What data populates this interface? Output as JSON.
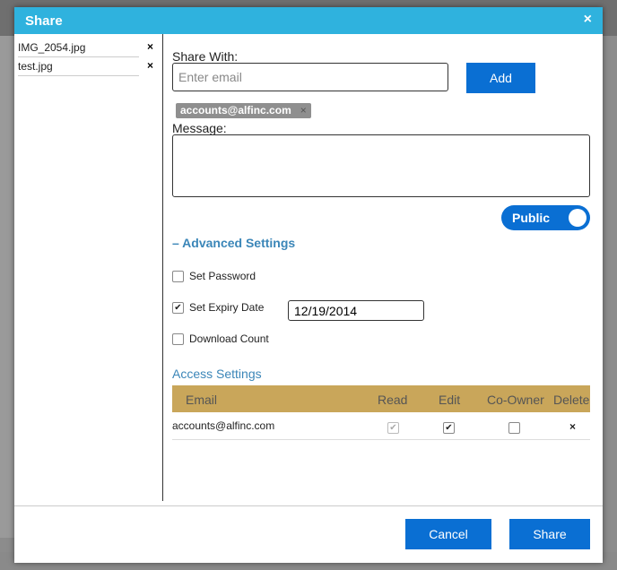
{
  "modal": {
    "title": "Share",
    "close_icon": "×"
  },
  "files": [
    {
      "name": "IMG_2054.jpg",
      "remove": "×"
    },
    {
      "name": "test.jpg",
      "remove": "×"
    }
  ],
  "share": {
    "share_with_label": "Share With:",
    "email_placeholder": "Enter email",
    "add_label": "Add",
    "chip_email": "accounts@alfinc.com",
    "chip_remove": "×",
    "message_label": "Message:"
  },
  "toggle": {
    "label": "Public",
    "state": "on"
  },
  "advanced": {
    "label": "– Advanced Settings",
    "options": [
      {
        "label": "Set Password",
        "checked": false
      },
      {
        "label": "Set Expiry Date",
        "checked": true
      },
      {
        "label": "Download Count",
        "checked": false
      }
    ],
    "expiry_value": "12/19/2014"
  },
  "access": {
    "title": "Access Settings",
    "columns": [
      "Email",
      "Read",
      "Edit",
      "Co-Owner",
      "Delete"
    ],
    "rows": [
      {
        "email": "accounts@alfinc.com",
        "read": true,
        "edit": true,
        "co_owner": false,
        "delete": "×"
      }
    ]
  },
  "footer": {
    "cancel_label": "Cancel",
    "share_label": "Share"
  },
  "colors": {
    "header": "#2fb2de",
    "button": "#0a6fd3",
    "table_header": "#c9a65a",
    "link": "#3b86b8"
  }
}
